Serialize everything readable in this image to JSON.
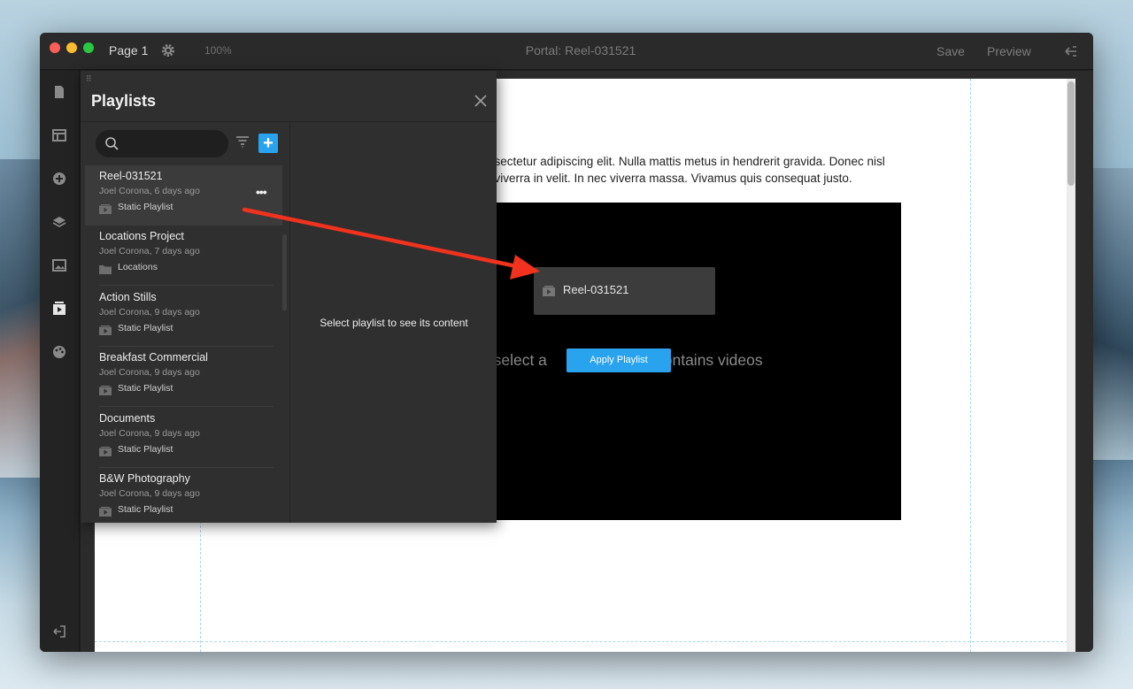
{
  "window": {
    "page_label": "Page 1",
    "zoom": "100%",
    "title": "Portal: Reel-031521",
    "save_label": "Save",
    "preview_label": "Preview"
  },
  "leftbar": {
    "icons": [
      "pages-icon",
      "layout-icon",
      "add-icon",
      "layers-icon",
      "image-icon",
      "playlist-icon",
      "palette-icon",
      "exit-icon"
    ]
  },
  "page": {
    "lorem_line1": "nsectetur adipiscing elit. Nulla mattis metus in hendrerit gravida. Donec nisl",
    "lorem_line2": ", viverra in velit. In nec viverra massa. Vivamus quis consequat justo.",
    "video_msg_left": "e select a",
    "video_msg_right": "contains videos",
    "drag_chip_label": "Reel-031521",
    "apply_label": "Apply Playlist"
  },
  "panel": {
    "title": "Playlists",
    "search_placeholder": "",
    "empty_message": "Select playlist to see its content",
    "items": [
      {
        "name": "Reel-031521",
        "meta": "Joel Corona, 6 days ago",
        "type": "Static Playlist",
        "icon": "play-icon",
        "selected": true
      },
      {
        "name": "Locations Project",
        "meta": "Joel Corona, 7 days ago",
        "type": "Locations",
        "icon": "folder-icon",
        "selected": false
      },
      {
        "name": "Action Stills",
        "meta": "Joel Corona, 9 days ago",
        "type": "Static Playlist",
        "icon": "play-icon",
        "selected": false
      },
      {
        "name": "Breakfast Commercial",
        "meta": "Joel Corona, 9 days ago",
        "type": "Static Playlist",
        "icon": "play-icon",
        "selected": false
      },
      {
        "name": "Documents",
        "meta": "Joel Corona, 9 days ago",
        "type": "Static Playlist",
        "icon": "play-icon",
        "selected": false
      },
      {
        "name": "B&W Photography",
        "meta": "Joel Corona, 9 days ago",
        "type": "Static Playlist",
        "icon": "play-icon",
        "selected": false
      }
    ]
  },
  "colors": {
    "accent": "#2aa3ef",
    "annotation_arrow": "#f0321e"
  }
}
